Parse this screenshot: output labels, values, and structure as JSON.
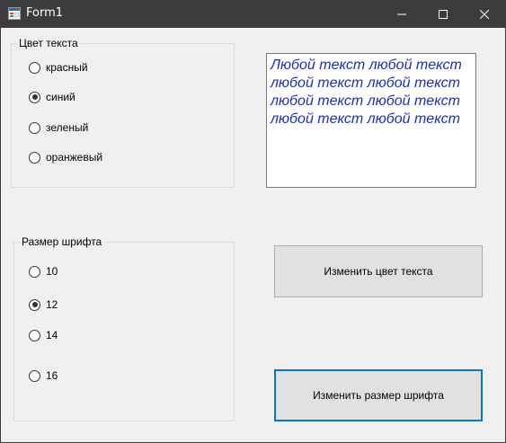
{
  "window": {
    "title": "Form1"
  },
  "color_group": {
    "caption": "Цвет текста",
    "options": [
      {
        "label": "красный",
        "checked": false
      },
      {
        "label": "синий",
        "checked": true
      },
      {
        "label": "зеленый",
        "checked": false
      },
      {
        "label": "оранжевый",
        "checked": false
      }
    ]
  },
  "size_group": {
    "caption": "Размер шрифта",
    "options": [
      {
        "label": "10",
        "checked": false
      },
      {
        "label": "12",
        "checked": true
      },
      {
        "label": "14",
        "checked": false
      },
      {
        "label": "16",
        "checked": false
      }
    ]
  },
  "text_area": {
    "lines": [
      "Любой текст любой текст",
      "любой текст любой текст",
      "любой текст любой текст",
      "любой текст любой текст"
    ],
    "color": "#1a2fbf"
  },
  "buttons": {
    "change_color": "Изменить цвет текста",
    "change_size": "Изменить размер шрифта"
  },
  "colors": {
    "titlebar": "#3c3c3c",
    "form_background": "#f0f0f0",
    "focus_border": "#0078d7"
  }
}
